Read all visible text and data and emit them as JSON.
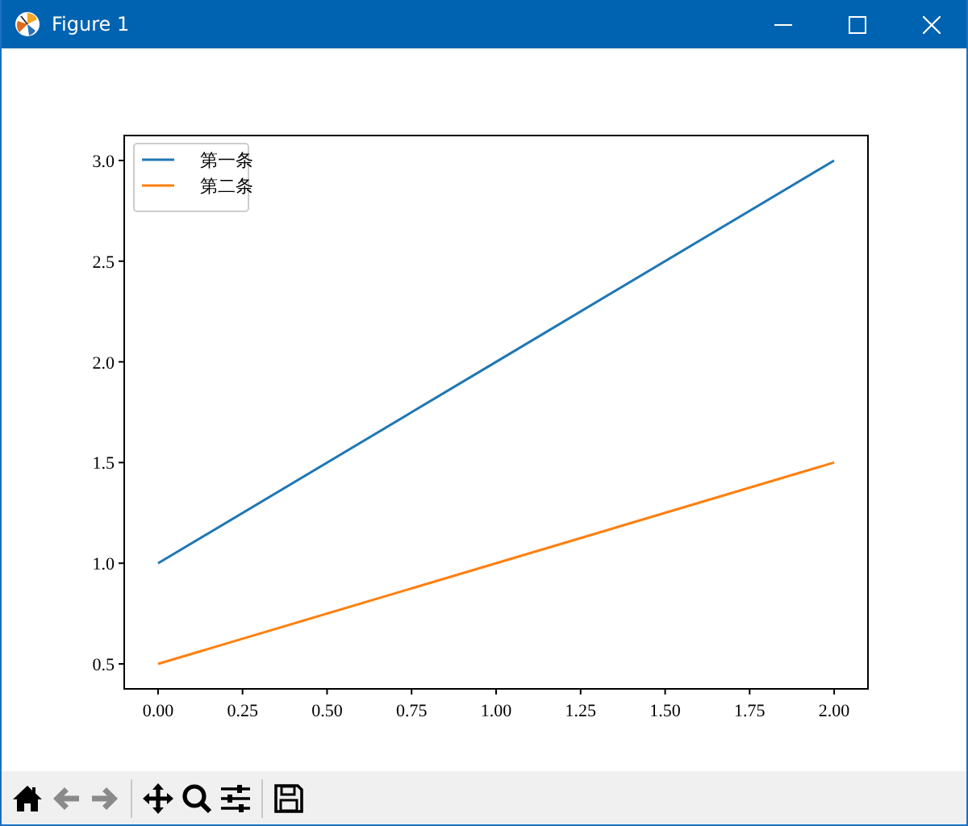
{
  "window": {
    "title": "Figure 1"
  },
  "figure": {
    "chart_data": {
      "type": "line",
      "legend": "upper left",
      "x": [
        0,
        1,
        2
      ],
      "xlim": [
        -0.1,
        2.1
      ],
      "ylim": [
        0.376,
        3.124
      ],
      "xticks": [
        {
          "value": 0,
          "label": "0.00"
        },
        {
          "value": 0.25,
          "label": "0.25"
        },
        {
          "value": 0.5,
          "label": "0.50"
        },
        {
          "value": 0.75,
          "label": "0.75"
        },
        {
          "value": 1,
          "label": "1.00"
        },
        {
          "value": 1.25,
          "label": "1.25"
        },
        {
          "value": 1.5,
          "label": "1.50"
        },
        {
          "value": 1.75,
          "label": "1.75"
        },
        {
          "value": 2,
          "label": "2.00"
        }
      ],
      "yticks": [
        {
          "value": 0.5,
          "label": "0.5"
        },
        {
          "value": 1,
          "label": "1.0"
        },
        {
          "value": 1.5,
          "label": "1.5"
        },
        {
          "value": 2,
          "label": "2.0"
        },
        {
          "value": 2.5,
          "label": "2.5"
        },
        {
          "value": 3,
          "label": "3.0"
        }
      ],
      "series": [
        {
          "name": "第一条",
          "color": "#1f77b4",
          "values": [
            1,
            2,
            3
          ]
        },
        {
          "name": "第二条",
          "color": "#ff7f0e",
          "values": [
            0.5,
            1,
            1.5
          ]
        }
      ]
    }
  },
  "toolbar": [
    {
      "kind": "home",
      "disabled": false
    },
    {
      "kind": "back",
      "disabled": true
    },
    {
      "kind": "forward",
      "disabled": true
    },
    {
      "kind": "separator"
    },
    {
      "kind": "pan",
      "disabled": false
    },
    {
      "kind": "zoom",
      "disabled": false
    },
    {
      "kind": "configure",
      "disabled": false
    },
    {
      "kind": "separator"
    },
    {
      "kind": "save",
      "disabled": false
    }
  ]
}
